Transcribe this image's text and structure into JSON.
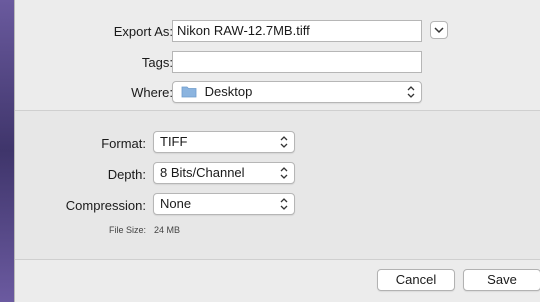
{
  "export_sheet": {
    "export_as_label": "Export As:",
    "export_as_value": "Nikon RAW-12.7MB.tiff",
    "tags_label": "Tags:",
    "tags_value": "",
    "where_label": "Where:",
    "where_value": "Desktop"
  },
  "options": {
    "format_label": "Format:",
    "format_value": "TIFF",
    "depth_label": "Depth:",
    "depth_value": "8 Bits/Channel",
    "compression_label": "Compression:",
    "compression_value": "None",
    "file_size_label": "File Size:",
    "file_size_value": "24 MB"
  },
  "buttons": {
    "cancel": "Cancel",
    "save": "Save"
  },
  "icons": [
    "chevron-down-icon",
    "folder-icon",
    "updown-arrows-icon"
  ],
  "colors": {
    "folder": "#8bb4df",
    "backdrop": "#5b4a86"
  }
}
